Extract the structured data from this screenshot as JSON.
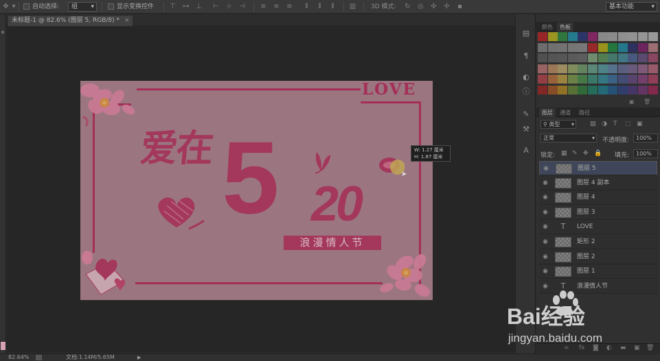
{
  "options_bar": {
    "auto_select_label": "自动选择:",
    "auto_select_value": "组",
    "show_transform_label": "显示变换控件",
    "mode_3d_label": "3D 模式:",
    "workspace_value": "基本功能"
  },
  "document": {
    "tab_title": "未标题-1 @ 82.6% (图层 5, RGB/8) *",
    "close_glyph": "×"
  },
  "artwork": {
    "love_text": "LOVE",
    "title_text": "爱在",
    "five": "5",
    "twenty": "20",
    "subtitle": "浪漫情人节"
  },
  "measure_tooltip": {
    "w": "W: 1.27 厘米",
    "h": "H: 1.87 厘米"
  },
  "status": {
    "zoom": "82.64%",
    "doc_size": "文档:1.14M/5.65M"
  },
  "swatches_panel": {
    "tabs": [
      "颜色",
      "色板"
    ],
    "active_tab": 1,
    "rows": [
      [
        "#ef1f24",
        "#f6ea15",
        "#2fb34a",
        "#1db9dd",
        "#2b3a97",
        "#c21f8c",
        "#d4d4d4",
        "#d7d7d7",
        "#dedede",
        "#e4e4e4",
        "#e9e9e9",
        "#f1f1f1"
      ],
      [
        "#a1a1a1",
        "#a5a5a5",
        "#aaaaaa",
        "#b0b0b0",
        "#b5b5b5",
        "#ec2528",
        "#f1e60f",
        "#1ab24b",
        "#1cb4d9",
        "#2e3287",
        "#a31e87",
        "#f6a0a8"
      ],
      [
        "#6c6c6c",
        "#727272",
        "#777777",
        "#7d7d7d",
        "#838383",
        "#a6d7a0",
        "#6fbf6f",
        "#58b59c",
        "#4fb2c7",
        "#5c7ac0",
        "#7f5ea6",
        "#d25a88"
      ],
      [
        "#f08e8e",
        "#f4b37a",
        "#f8d989",
        "#c4d881",
        "#8ec987",
        "#7ecfb0",
        "#6bc9d2",
        "#74a8d8",
        "#7d87c3",
        "#9b7eba",
        "#c27cb4",
        "#ef7f9f"
      ],
      [
        "#e84b57",
        "#ef8c44",
        "#f3c94a",
        "#9cc75b",
        "#5bb65d",
        "#44b69b",
        "#3bb5c6",
        "#4389c8",
        "#5464ae",
        "#7c55a3",
        "#ad4f9c",
        "#e24c7b"
      ],
      [
        "#c4231f",
        "#d3661f",
        "#e1a81d",
        "#7aa63c",
        "#339b42",
        "#1d9c7d",
        "#1a9bb1",
        "#1f6db2",
        "#3249a0",
        "#5a3c97",
        "#8e3a91",
        "#c72566"
      ]
    ]
  },
  "layers_panel": {
    "tabs": [
      "图层",
      "通道",
      "路径"
    ],
    "active_tab": 0,
    "filter_label": "类型",
    "blend_mode": "正常",
    "opacity_label": "不透明度:",
    "opacity_value": "100%",
    "lock_label": "锁定:",
    "fill_label": "填充:",
    "fill_value": "100%",
    "layers": [
      {
        "name": "图层 5",
        "type": "pixel",
        "selected": true
      },
      {
        "name": "图层 4 副本",
        "type": "pixel",
        "selected": false
      },
      {
        "name": "图层 4",
        "type": "pixel",
        "selected": false
      },
      {
        "name": "图层 3",
        "type": "pixel",
        "selected": false
      },
      {
        "name": "LOVE",
        "type": "text",
        "selected": false
      },
      {
        "name": "矩形 2",
        "type": "pixel",
        "selected": false
      },
      {
        "name": "图层 2",
        "type": "pixel",
        "selected": false
      },
      {
        "name": "图层 1",
        "type": "pixel",
        "selected": false
      },
      {
        "name": "浪漫情人节",
        "type": "text",
        "selected": false
      }
    ]
  },
  "watermark": {
    "brand": "Bai经验",
    "url": "jingyan.baidu.com"
  },
  "colors": {
    "accent_magenta": "#a42e57",
    "selection_blue": "#3f4659"
  }
}
